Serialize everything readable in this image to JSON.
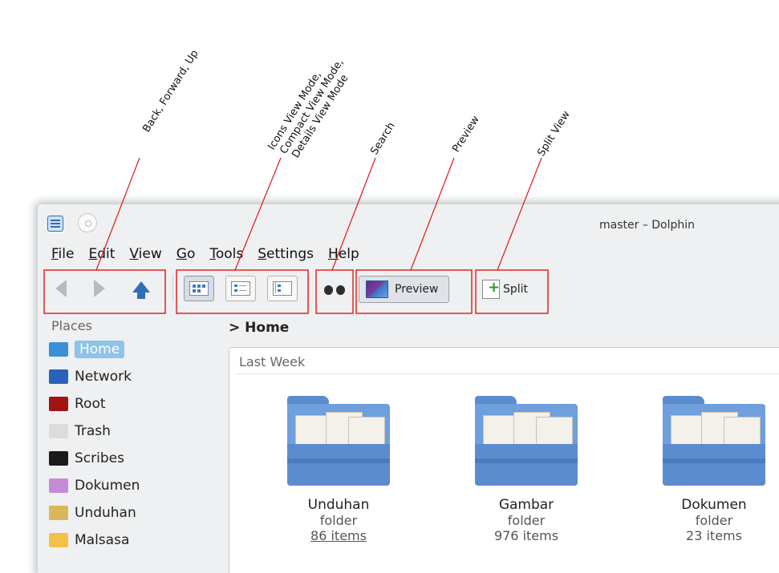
{
  "annotations": {
    "back_forward_up": "Back, Forward, Up",
    "view_modes": [
      "Icons View Mode,",
      "Compact View Mode,",
      "Details View Mode"
    ],
    "search": "Search",
    "preview": "Preview",
    "split_view": "Split View",
    "line_color": "#e01818"
  },
  "window": {
    "title": "master – Dolphin"
  },
  "menubar": [
    "File",
    "Edit",
    "View",
    "Go",
    "Tools",
    "Settings",
    "Help"
  ],
  "toolbar": {
    "preview_label": "Preview",
    "split_label": "Split"
  },
  "places": {
    "header": "Places",
    "items": [
      {
        "label": "Home",
        "icon": "home-folder-icon",
        "color": "#3b8fd9",
        "selected": true
      },
      {
        "label": "Network",
        "icon": "network-globe-icon",
        "color": "#2a62b8",
        "selected": false
      },
      {
        "label": "Root",
        "icon": "root-folder-icon",
        "color": "#a01414",
        "selected": false
      },
      {
        "label": "Trash",
        "icon": "trash-icon",
        "color": "#dcdcdc",
        "selected": false
      },
      {
        "label": "Scribes",
        "icon": "scribes-folder-icon",
        "color": "#1a1a1a",
        "selected": false
      },
      {
        "label": "Dokumen",
        "icon": "documents-folder-icon",
        "color": "#c58ad6",
        "selected": false
      },
      {
        "label": "Unduhan",
        "icon": "downloads-folder-icon",
        "color": "#d9b85c",
        "selected": false
      },
      {
        "label": "Malsasa",
        "icon": "folder-icon",
        "color": "#f2c14a",
        "selected": false
      }
    ]
  },
  "breadcrumb": {
    "chevron": ">",
    "current": "Home"
  },
  "view": {
    "group_header": "Last Week",
    "items": [
      {
        "name": "Unduhan",
        "type": "folder",
        "count": "86 items"
      },
      {
        "name": "Gambar",
        "type": "folder",
        "count": "976 items"
      },
      {
        "name": "Dokumen",
        "type": "folder",
        "count": "23 items"
      }
    ]
  }
}
